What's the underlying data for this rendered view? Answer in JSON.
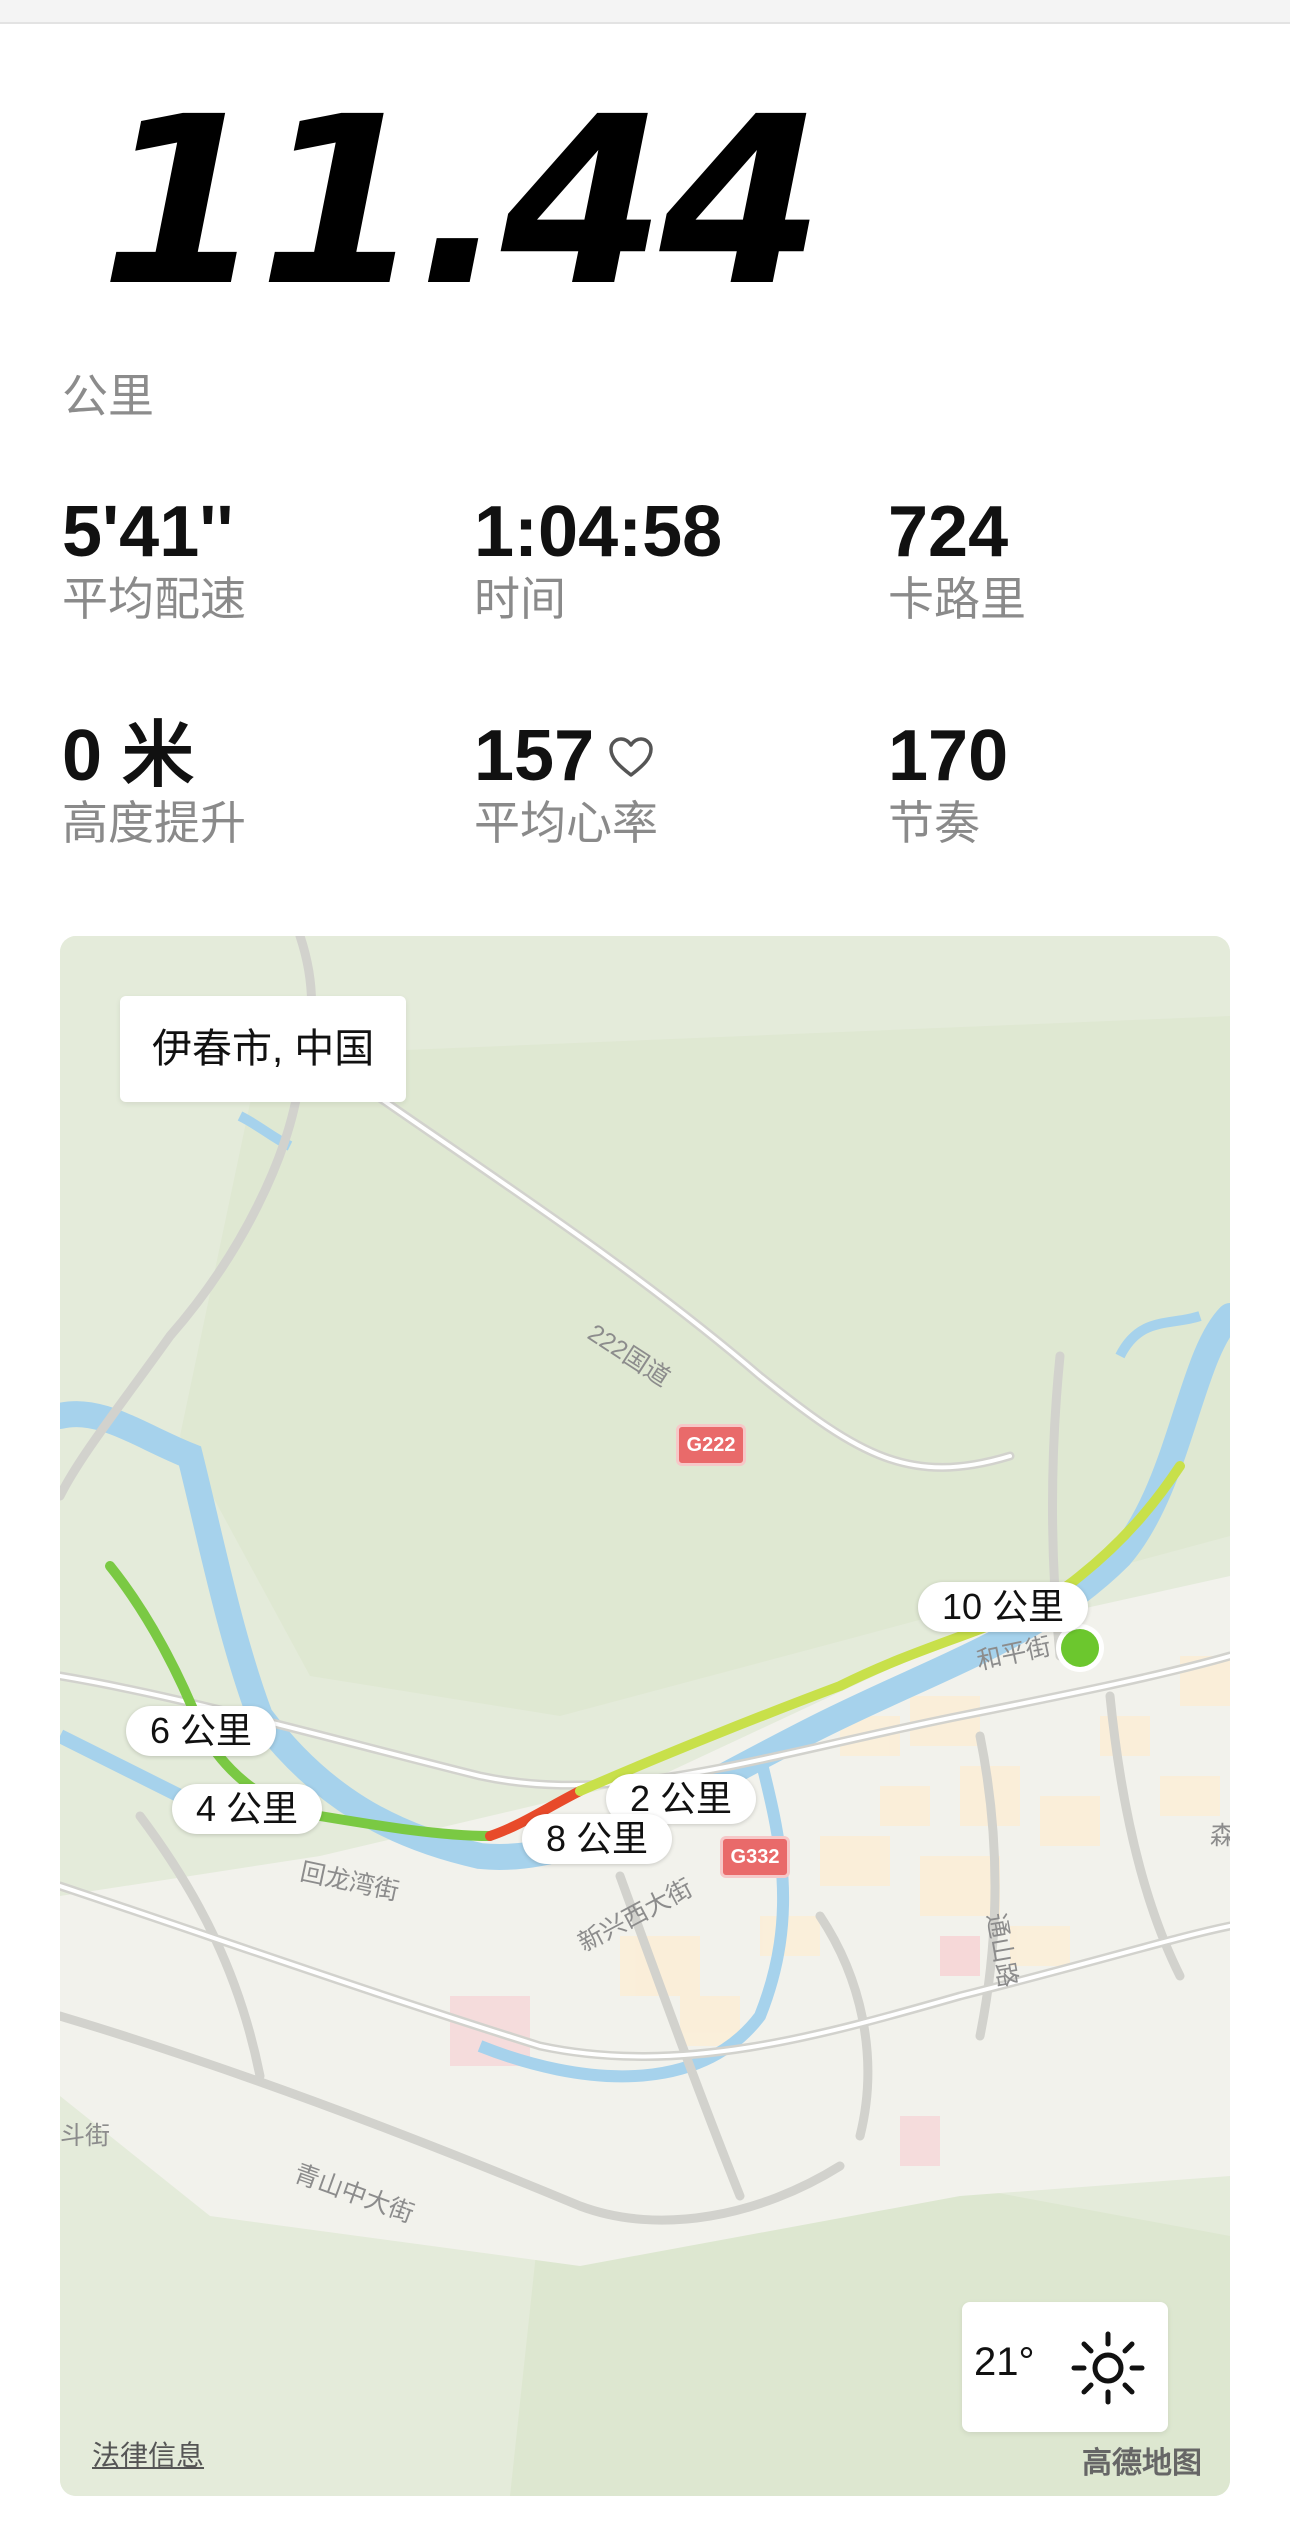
{
  "summary": {
    "distance": "11.44",
    "distance_unit": "公里"
  },
  "stats": [
    {
      "value": "5'41''",
      "label": "平均配速"
    },
    {
      "value": "1:04:58",
      "label": "时间"
    },
    {
      "value": "724",
      "label": "卡路里"
    },
    {
      "value": "0 米",
      "label": "高度提升"
    },
    {
      "value": "157",
      "label": "平均心率",
      "icon": "heart-icon"
    },
    {
      "value": "170",
      "label": "节奏"
    }
  ],
  "map": {
    "location": "伊春市, 中国",
    "km_markers": [
      "10 公里",
      "6 公里",
      "4 公里",
      "2 公里",
      "8 公里"
    ],
    "road_labels": [
      "222国道",
      "和平街",
      "回龙湾街",
      "新兴西大街",
      "通山路",
      "青山中大街",
      "斗街",
      "森"
    ],
    "shields": [
      "G222",
      "G332"
    ],
    "weather": {
      "temperature": "21°",
      "icon": "sun-icon"
    },
    "legal_link": "法律信息",
    "provider": "高德地图",
    "colors": {
      "route_fast": "#7ac943",
      "route_medium": "#c8e04a",
      "route_slow": "#e84a2a",
      "end_point": "#6cc72e",
      "river": "#a6d2ec",
      "land": "#e6ecdd"
    }
  }
}
